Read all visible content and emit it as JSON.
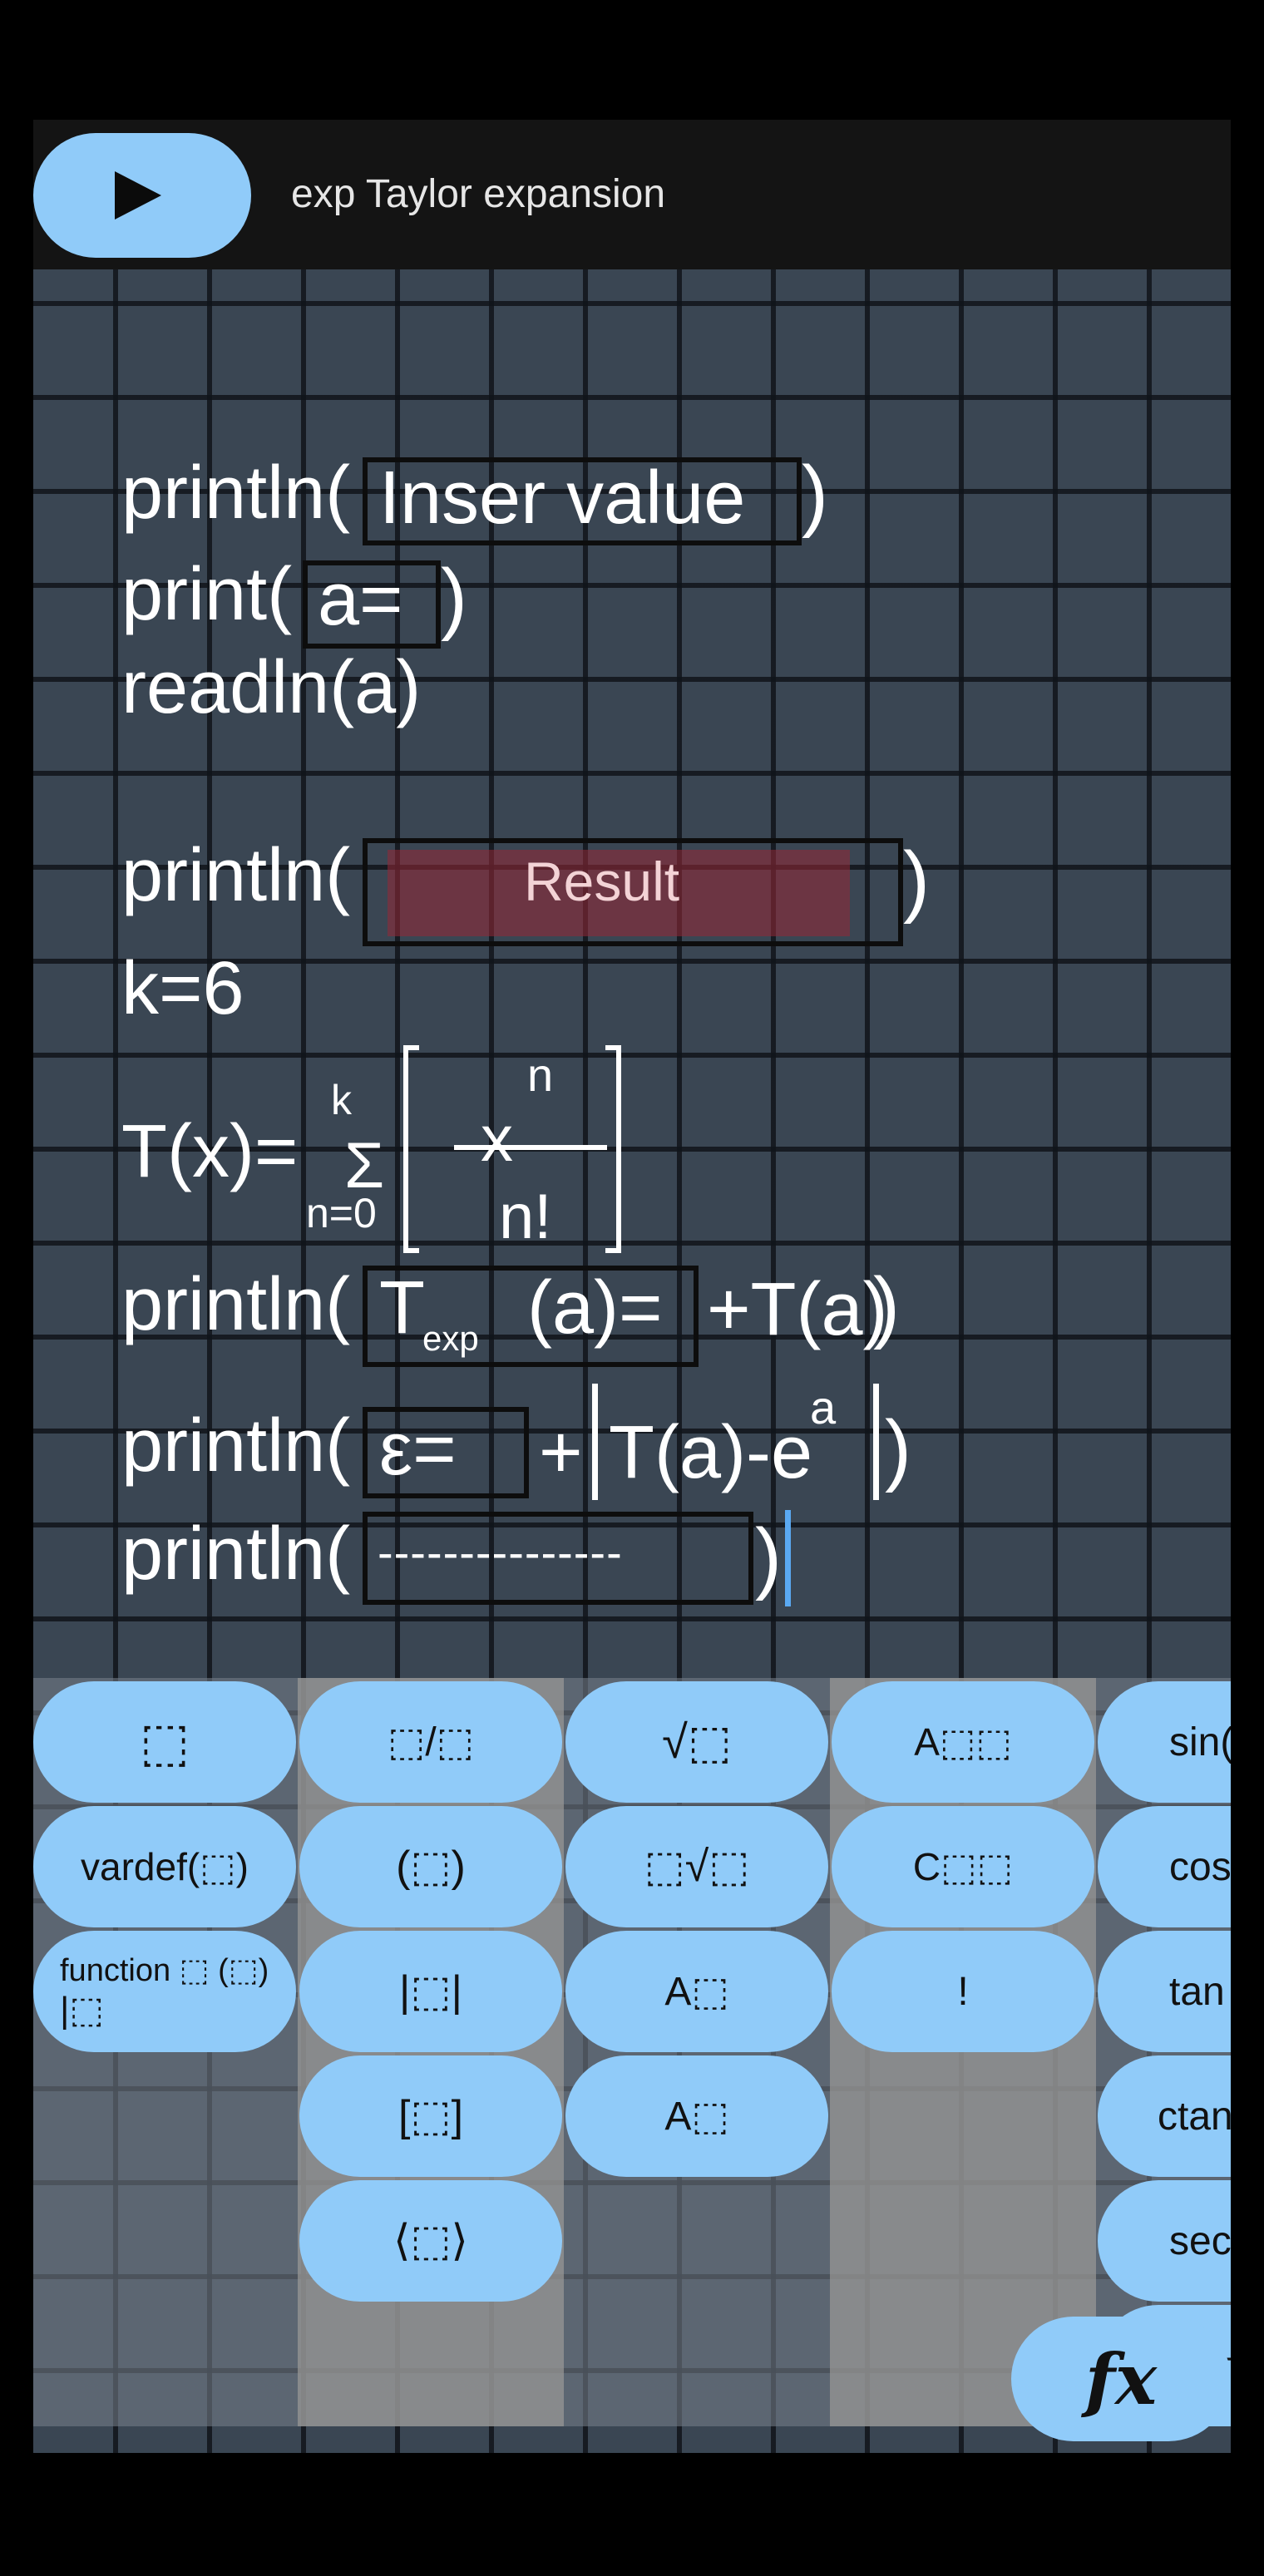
{
  "header": {
    "title": "exp Taylor expansion",
    "run_icon": "play-icon"
  },
  "code": {
    "line1": {
      "fn": "println(",
      "arg": "Inser value",
      "close": ")"
    },
    "line2": {
      "fn": "print(",
      "arg": "a=",
      "close": ")"
    },
    "line3": {
      "text": "readln(a)"
    },
    "line4": {
      "fn": "println(",
      "arg": "Result",
      "close": ")"
    },
    "line5": {
      "text": "k=6"
    },
    "line6": {
      "lhs": "T(x)=",
      "sigma": "Σ",
      "upper": "k",
      "lower": "n=0",
      "num_base": "x",
      "num_exp": "n",
      "den": "n!"
    },
    "line7": {
      "fn": "println(",
      "arg_main": "T",
      "arg_sub": "exp",
      "arg_rest": "(a)=",
      "after": "+T(a)",
      "close": ")"
    },
    "line8": {
      "fn": "println(",
      "arg": "ε=",
      "plus": "+",
      "abs_content": "T(a)-e",
      "abs_exp": "a",
      "close": ")"
    },
    "line9": {
      "fn": "println(",
      "arg": "---------------",
      "close": ")"
    }
  },
  "keypad": {
    "col1": [
      {
        "label": "⬚"
      },
      {
        "label": "vardef(⬚)"
      },
      {
        "label": "function ⬚ (⬚)",
        "label2": "|⬚"
      }
    ],
    "col2": [
      {
        "label": "⬚/⬚"
      },
      {
        "label": "(⬚)"
      },
      {
        "label": "|⬚|"
      },
      {
        "label": "[⬚]"
      },
      {
        "label": "⟨⬚⟩"
      }
    ],
    "col3": [
      {
        "label": "√⬚"
      },
      {
        "label": "⬚√⬚"
      },
      {
        "label": "A⬚"
      },
      {
        "label": "A⬚"
      }
    ],
    "col4": [
      {
        "label": "A⬚⬚"
      },
      {
        "label": "C⬚⬚"
      },
      {
        "label": "!"
      }
    ],
    "col5": [
      {
        "label": "sin("
      },
      {
        "label": "cos"
      },
      {
        "label": "tan"
      },
      {
        "label": "ctan"
      },
      {
        "label": "sec"
      },
      {
        "label": "π"
      }
    ],
    "fx_label": "fx"
  },
  "colors": {
    "key_bg": "#90cbf9",
    "editor_bg": "#3a4653",
    "topbar_bg": "#141414",
    "cursor": "#5aa9f2"
  }
}
